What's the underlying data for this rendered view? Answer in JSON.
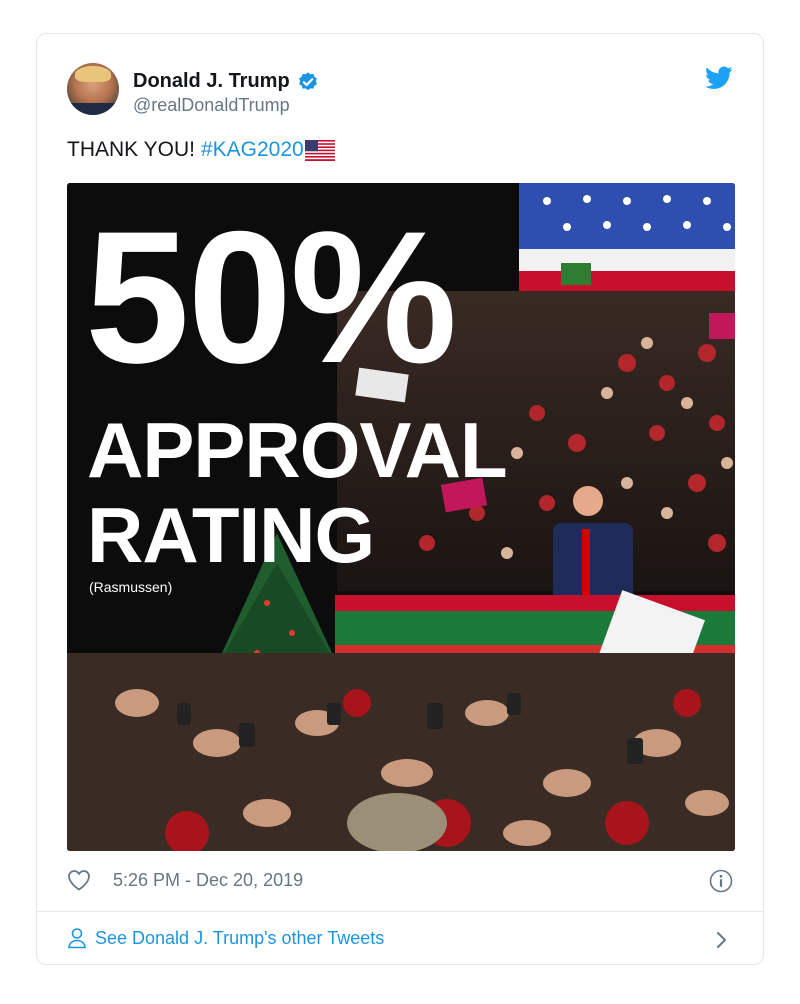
{
  "tweet": {
    "author_name": "Donald J. Trump",
    "handle": "@realDonaldTrump",
    "text": "THANK YOU!",
    "hashtag": "#KAG2020",
    "timestamp": "5:26 PM - Dec 20, 2019",
    "see_more": "See Donald J. Trump's other Tweets"
  },
  "media": {
    "headline_number": "50%",
    "headline_line1": "APPROVAL",
    "headline_line2": "RATING",
    "source": "(Rasmussen)"
  },
  "icons": [
    "verified-badge-icon",
    "twitter-bird-icon",
    "us-flag-emoji",
    "heart-icon",
    "info-icon",
    "person-icon",
    "chevron-right-icon"
  ],
  "colors": {
    "accent": "#1b95e0",
    "text": "#14171a",
    "muted": "#657786",
    "border": "#e1e8ed"
  }
}
